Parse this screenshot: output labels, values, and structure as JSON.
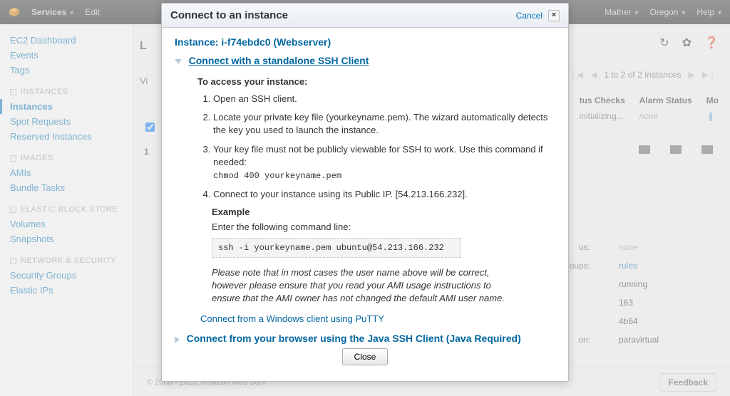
{
  "topnav": {
    "services": "Services",
    "edit": "Edit",
    "user": "Mather",
    "region": "Oregon",
    "help": "Help"
  },
  "sidebar": {
    "top": [
      "EC2 Dashboard",
      "Events",
      "Tags"
    ],
    "sections": [
      {
        "title": "INSTANCES",
        "items": [
          "Instances",
          "Spot Requests",
          "Reserved Instances"
        ],
        "active": 0
      },
      {
        "title": "IMAGES",
        "items": [
          "AMIs",
          "Bundle Tasks"
        ]
      },
      {
        "title": "ELASTIC BLOCK STORE",
        "items": [
          "Volumes",
          "Snapshots"
        ]
      },
      {
        "title": "NETWORK & SECURITY",
        "items": [
          "Security Groups",
          "Elastic IPs"
        ]
      }
    ]
  },
  "pager": {
    "text": "1 to 2 of 2 Instances"
  },
  "table": {
    "headers": {
      "status": "tus Checks",
      "alarm": "Alarm Status",
      "mo": "Mo"
    },
    "row": {
      "status": "initializing...",
      "alarm": "none"
    }
  },
  "details": {
    "rows": [
      {
        "k": "us:",
        "v": "none"
      },
      {
        "k": "oups:",
        "v": "rules",
        "blue": true
      },
      {
        "k": "",
        "v": "running"
      },
      {
        "k": "",
        "v": "163"
      },
      {
        "k": "",
        "v": "4b64"
      },
      {
        "k": "on:",
        "v": "paravirtual"
      }
    ]
  },
  "footer": {
    "copy": "© 2008 - 2013, Amazon Web Serv",
    "feedback": "Feedback"
  },
  "modal": {
    "title": "Connect to an instance",
    "cancel": "Cancel",
    "instance_label": "Instance:",
    "instance_value": "i-f74ebdc0 (Webserver)",
    "expand1": "Connect with a standalone SSH Client",
    "access_h": "To access your instance:",
    "steps": [
      "Open an SSH client.",
      "Locate your private key file (yourkeyname.pem). The wizard automatically detects the key you used to launch the instance.",
      {
        "text": "Your key file must not be publicly viewable for SSH to work. Use this command if needed:",
        "code": "chmod 400 yourkeyname.pem"
      },
      "Connect to your instance using its Public IP. [54.213.166.232]."
    ],
    "example_h": "Example",
    "enter": "Enter the following command line:",
    "cmd": "ssh -i yourkeyname.pem ubuntu@54.213.166.232",
    "note": "Please note that in most cases the user name above will be correct, however please ensure that you read your AMI usage instructions to ensure that the AMI owner has not changed the default AMI user name.",
    "putty": "Connect from a Windows client using PuTTY",
    "expand2": "Connect from your browser using the Java SSH Client (Java Required)",
    "close": "Close"
  }
}
